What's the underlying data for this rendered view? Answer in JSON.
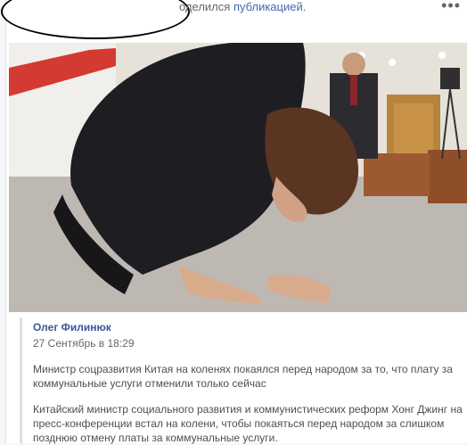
{
  "post": {
    "shared_text": "оделился",
    "shared_link": "публикацией",
    "shared_period": ".",
    "more_glyph": "•••"
  },
  "shared_post": {
    "author": "Олег Филинюк",
    "date": "27 Сентябрь в 18:29",
    "paragraph1": "Министр соцразвития Китая на коленях покаялся перед народом за то, что плату за коммунальные услуги отменили только сейчас",
    "paragraph2": "Китайский министр социального развития и коммунистических реформ Хонг Джинг на пресс-конференции встал на колени, чтобы покаяться перед народом за слишком позднюю отмену платы за коммунальные услуги."
  },
  "colors": {
    "link": "#4267b2",
    "author": "#385898",
    "text": "#4b4f56",
    "muted": "#616770"
  },
  "icons": [
    "more-options-icon"
  ]
}
